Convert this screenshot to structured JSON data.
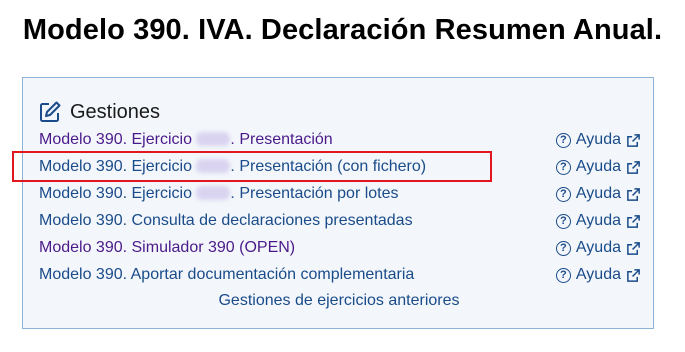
{
  "page": {
    "title": "Modelo 390. IVA. Declaración Resumen Anual."
  },
  "panel": {
    "title": "Gestiones",
    "items": [
      {
        "prefix": "Modelo 390. Ejercicio",
        "blurred": true,
        "suffix": ". Presentación",
        "visited": true,
        "help": "Ayuda"
      },
      {
        "prefix": "Modelo 390. Ejercicio",
        "blurred": true,
        "suffix": ". Presentación (con fichero)",
        "visited": false,
        "help": "Ayuda"
      },
      {
        "prefix": "Modelo 390. Ejercicio",
        "blurred": true,
        "suffix": ". Presentación por lotes",
        "visited": false,
        "help": "Ayuda"
      },
      {
        "prefix": "Modelo 390. Consulta de declaraciones presentadas",
        "blurred": false,
        "suffix": "",
        "visited": false,
        "help": "Ayuda"
      },
      {
        "prefix": "Modelo 390. Simulador 390 (OPEN)",
        "blurred": false,
        "suffix": "",
        "visited": true,
        "help": "Ayuda"
      },
      {
        "prefix": "Modelo 390. Aportar documentación complementaria",
        "blurred": false,
        "suffix": "",
        "visited": false,
        "help": "Ayuda"
      }
    ],
    "footer_link": "Gestiones de ejercicios anteriores"
  },
  "colors": {
    "link": "#1a4b8a",
    "visited": "#4b1a8a",
    "highlight": "#e2161f",
    "panel_border": "#8db3d8",
    "panel_bg": "#f3f7fb"
  }
}
